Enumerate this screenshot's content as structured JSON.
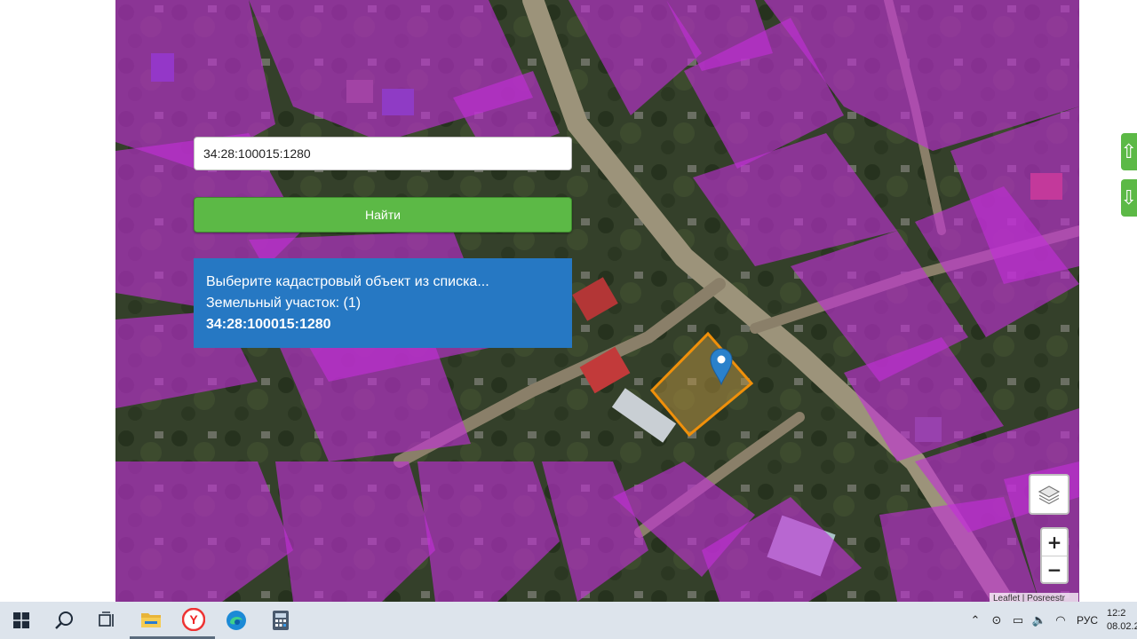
{
  "search": {
    "value": "34:28:100015:1280",
    "button_label": "Найти"
  },
  "results": {
    "prompt": "Выберите кадастровый объект из списка...",
    "group_label": "Земельный участок: (1)",
    "items": [
      "34:28:100015:1280"
    ]
  },
  "map": {
    "zoom_in_label": "+",
    "zoom_out_label": "−",
    "attribution": "Leaflet | Рosreestr",
    "parcel_color": "#f0900a",
    "marker_color": "#2a81cb",
    "overlay_color": "#c22fd6",
    "layers_icon": "layers-icon"
  },
  "side_buttons": {
    "up_icon": "arrow-up-icon",
    "down_icon": "arrow-down-icon"
  },
  "taskbar": {
    "apps": [
      "windows-start-icon",
      "search-icon",
      "task-view-icon",
      "file-explorer-icon",
      "yandex-browser-icon",
      "edge-icon",
      "calculator-icon"
    ],
    "language": "РУС",
    "time": "12:2",
    "date": "08.02.2"
  }
}
